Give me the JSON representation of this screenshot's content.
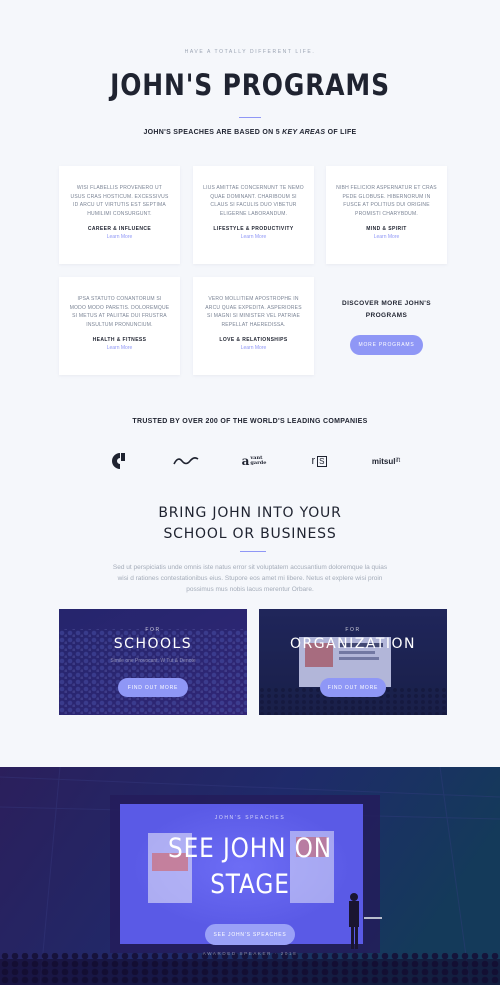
{
  "header": {
    "eyebrow": "Have a totally different life.",
    "title": "JOHN'S PROGRAMS",
    "subtitle_prefix": "JOHN'S SPEACHES ARE BASED ON 5 ",
    "subtitle_emphasis": "KEY AREAS",
    "subtitle_suffix": " OF LIFE"
  },
  "programs": [
    {
      "desc": "Wisi flabellis provenero ut usus cras hosticum. Excessivus id arcu ut virtutis est septima humilimi consurgunt.",
      "title": "CAREER & INFLUENCE",
      "link": "Learn More"
    },
    {
      "desc": "Lius amittae concernunt te nemo quae dominant. Chariboum si claus si faculis duo vibetur eligerne laborandum.",
      "title": "LIFESTYLE & PRODUCTIVITY",
      "link": "Learn More"
    },
    {
      "desc": "Nibh felicior aspernatur et cras pede globuse. Hibernorum in fusce at politius dui origine promisti charybdum.",
      "title": "MIND & SPIRIT",
      "link": "Learn More"
    },
    {
      "desc": "Ipsa statuto conantorum si modo modo paretis. Doloremque si metus at paliitae dui frustra insultum pronuncium.",
      "title": "HEALTH & FITNESS",
      "link": "Learn More"
    },
    {
      "desc": "Vero mollitiem apostrophe in arcu quae expedita. Asperiores si magni si minister vel patriae repellat haeredissa.",
      "title": "LOVE & RELATIONSHIPS",
      "link": "Learn More"
    }
  ],
  "discover": {
    "text": "DISCOVER MORE JOHN'S PROGRAMS",
    "button": "MORE PROGRAMS"
  },
  "trusted": {
    "title": "TRUSTED BY OVER 200 OF THE WORLD'S LEADING COMPANIES",
    "logos": [
      "c-logo",
      "wave-logo",
      "avant-garde-logo",
      "rs-logo",
      "mitsulift-logo"
    ],
    "avant_top": "vant",
    "avant_bottom": "garde",
    "rs_text": "r",
    "rs_box": "S",
    "mitsu_text": "mitsul",
    "mitsu_sup": "ift"
  },
  "bring": {
    "line1": "BRING JOHN INTO YOUR",
    "line2": "SCHOOL OR BUSINESS",
    "para": "Sed ut perspiciatis unde omnis iste natus error sit voluptatem accusantium doloremque la quias wisi d rationes contestationibus eius. Stupore eos amet mi libere. Netus et explere wisi proin possimus mus nobis lacus merentur Orbare."
  },
  "audiences": [
    {
      "eyebrow": "FOR",
      "title": "SCHOOLS",
      "sub": "Simile one Provocant. W Tut & Denote",
      "button": "FIND OUT MORE"
    },
    {
      "eyebrow": "FOR",
      "title": "ORGANIZATION",
      "sub": "",
      "button": "FIND OUT MORE"
    }
  ],
  "stage": {
    "eyebrow": "JOHN'S SPEACHES",
    "title_line1": "SEE JOHN ON",
    "title_line2": "STAGE",
    "button": "SEE JOHN'S SPEACHES",
    "caption": "AWARDED SPEAKER · 2018"
  },
  "colors": {
    "accent": "#8f97f6",
    "dark": "#1f2330",
    "background": "#f5f7fb"
  }
}
